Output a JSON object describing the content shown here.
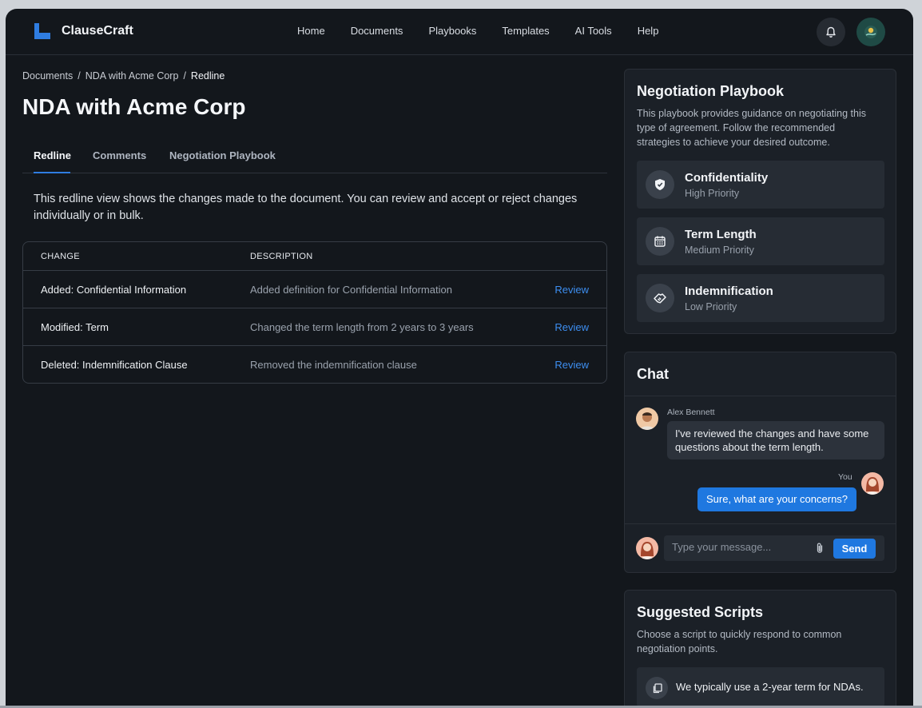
{
  "app": {
    "name": "ClauseCraft",
    "brand_color": "#2f7de1"
  },
  "nav": {
    "items": [
      "Home",
      "Documents",
      "Playbooks",
      "Templates",
      "AI Tools",
      "Help"
    ]
  },
  "header_icons": {
    "notifications": "bell-icon",
    "user": "user-avatar"
  },
  "breadcrumb": {
    "root": "Documents",
    "parent": "NDA with Acme Corp",
    "current": "Redline",
    "separator": "/"
  },
  "page": {
    "title": "NDA with Acme Corp"
  },
  "tabs": [
    {
      "label": "Redline",
      "active": true
    },
    {
      "label": "Comments",
      "active": false
    },
    {
      "label": "Negotiation Playbook",
      "active": false
    }
  ],
  "redline": {
    "intro": "This redline view shows the changes made to the document. You can review and accept or reject changes individually or in bulk.",
    "columns": {
      "change": "CHANGE",
      "description": "DESCRIPTION"
    },
    "rows": [
      {
        "change": "Added: Confidential Information",
        "description": "Added definition for Confidential Information",
        "action": "Review"
      },
      {
        "change": "Modified: Term",
        "description": "Changed the term length from 2 years to 3 years",
        "action": "Review"
      },
      {
        "change": "Deleted: Indemnification Clause",
        "description": "Removed the indemnification clause",
        "action": "Review"
      }
    ]
  },
  "playbook": {
    "title": "Negotiation Playbook",
    "description": "This playbook provides guidance on negotiating this type of agreement. Follow the recommended strategies to achieve your desired outcome.",
    "items": [
      {
        "name": "Confidentiality",
        "priority": "High Priority",
        "icon": "shield-icon"
      },
      {
        "name": "Term Length",
        "priority": "Medium Priority",
        "icon": "calendar-icon"
      },
      {
        "name": "Indemnification",
        "priority": "Low Priority",
        "icon": "handshake-icon"
      }
    ]
  },
  "chat": {
    "title": "Chat",
    "messages": [
      {
        "author": "Alex Bennett",
        "text": "I've reviewed the changes and have some questions about the term length."
      },
      {
        "author": "You",
        "text": "Sure, what are your concerns?"
      }
    ],
    "input_placeholder": "Type your message...",
    "send_label": "Send"
  },
  "scripts": {
    "title": "Suggested Scripts",
    "description": "Choose a script to quickly respond to common negotiation points.",
    "items": [
      {
        "text": "We typically use a 2-year term for NDAs.",
        "icon": "copy-icon"
      }
    ]
  }
}
